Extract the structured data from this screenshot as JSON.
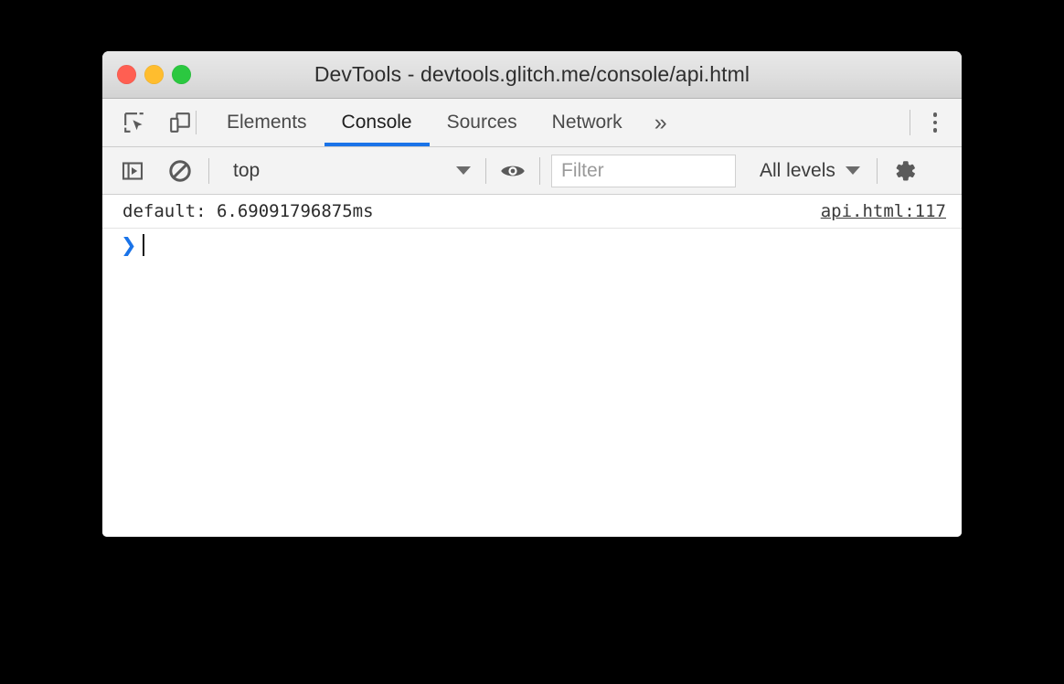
{
  "window": {
    "title": "DevTools - devtools.glitch.me/console/api.html",
    "traffic_lights": [
      {
        "name": "close",
        "color": "#ff5f52"
      },
      {
        "name": "minimize",
        "color": "#ffbd2e"
      },
      {
        "name": "maximize",
        "color": "#2bc840"
      }
    ]
  },
  "tabbar": {
    "inspect_icon": "inspect-element-icon",
    "device_icon": "device-toolbar-icon",
    "tabs": [
      {
        "label": "Elements",
        "active": false
      },
      {
        "label": "Console",
        "active": true
      },
      {
        "label": "Sources",
        "active": false
      },
      {
        "label": "Network",
        "active": false
      }
    ],
    "more_tabs_label": "»",
    "main_menu_icon": "more-vertical-icon",
    "active_tab_color": "#1a73e8"
  },
  "console_toolbar": {
    "sidebar_icon": "console-sidebar-icon",
    "clear_icon": "clear-console-icon",
    "context": {
      "value": "top",
      "caret_icon": "chevron-down-icon"
    },
    "live_expression_icon": "eye-icon",
    "filter": {
      "placeholder": "Filter",
      "value": ""
    },
    "levels": {
      "value": "All levels",
      "caret_icon": "chevron-down-icon"
    },
    "settings_icon": "gear-icon"
  },
  "console_body": {
    "messages": [
      {
        "text": "default: 6.69091796875ms",
        "source": "api.html:117"
      }
    ],
    "prompt": {
      "chevron": "❯",
      "value": ""
    }
  }
}
